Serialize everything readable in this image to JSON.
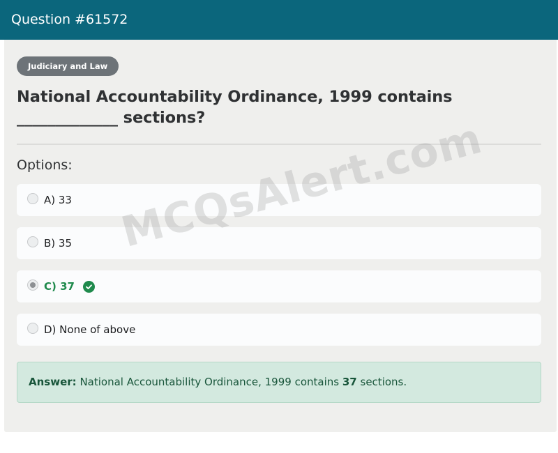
{
  "header": {
    "title": "Question #61572"
  },
  "category": {
    "label": "Judiciary and Law"
  },
  "question": {
    "text": "National Accountability Ordinance, 1999 contains _____________ sections?"
  },
  "options_label": "Options:",
  "options": [
    {
      "label": "A) 33",
      "selected": false,
      "correct": false
    },
    {
      "label": "B) 35",
      "selected": false,
      "correct": false
    },
    {
      "label": "C) 37",
      "selected": true,
      "correct": true
    },
    {
      "label": "D) None of above",
      "selected": false,
      "correct": false
    }
  ],
  "answer": {
    "prefix": "Answer:",
    "text_before": "National Accountability Ordinance, 1999 contains",
    "value": "37",
    "text_after": "sections."
  },
  "watermark": {
    "text": "MCQsAlert.com"
  },
  "colors": {
    "header_bg": "#0b667c",
    "correct": "#1f8a4c",
    "answer_bg": "#d3e9df"
  }
}
